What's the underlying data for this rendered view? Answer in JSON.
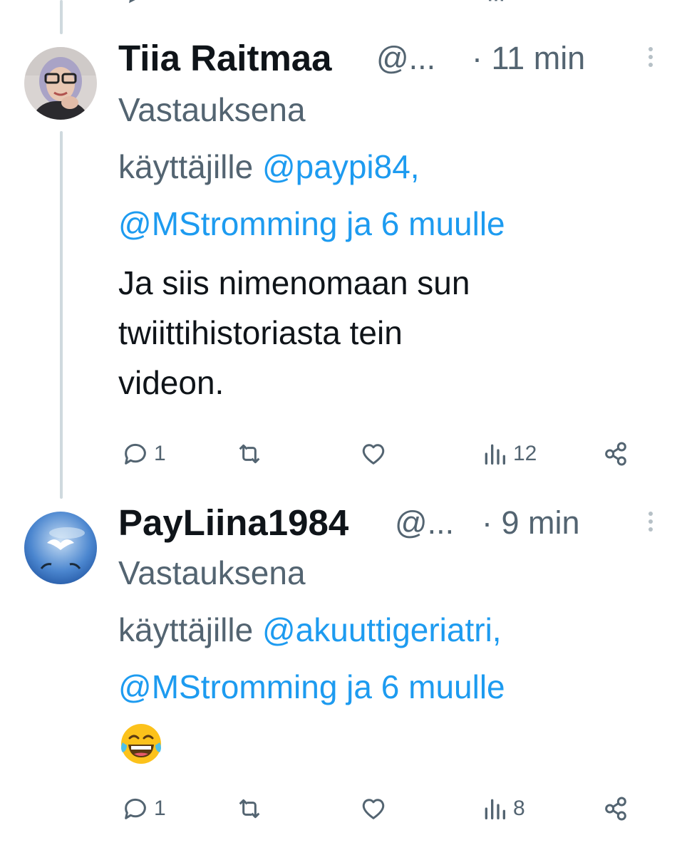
{
  "tweets": [
    {
      "name": "Tiia Raitmaa",
      "handle": "@...",
      "time": "· 11 min",
      "reply_prefix": "Vastauksena",
      "reply_line2_prefix": "käyttäjille ",
      "reply_mention1": "@paypi84,",
      "reply_mention2": "@MStromming ja 6 muulle",
      "body_lines": [
        "Ja siis nimenomaan sun",
        "twiittihistoriasta tein",
        "videon."
      ],
      "actions": {
        "reply_count": "1",
        "retweet_count": "",
        "like_count": "",
        "views_count": "12"
      }
    },
    {
      "name": "PayLiina1984",
      "handle": "@...",
      "time": "· 9 min",
      "reply_prefix": "Vastauksena",
      "reply_line2_prefix": "käyttäjille ",
      "reply_mention1": "@akuuttigeriatri,",
      "reply_mention2": "@MStromming ja 6 muulle",
      "body_emoji": "face-with-tears-of-joy",
      "actions": {
        "reply_count": "1",
        "retweet_count": "",
        "like_count": "",
        "views_count": "8"
      }
    }
  ],
  "icons": {
    "reply": "reply-icon",
    "retweet": "retweet-icon",
    "like": "heart-icon",
    "views": "views-icon",
    "share": "share-icon",
    "more": "more-icon"
  },
  "colors": {
    "link": "#1d9bf0",
    "muted": "#536471",
    "text": "#0f1419",
    "thread": "#cfd9de"
  }
}
